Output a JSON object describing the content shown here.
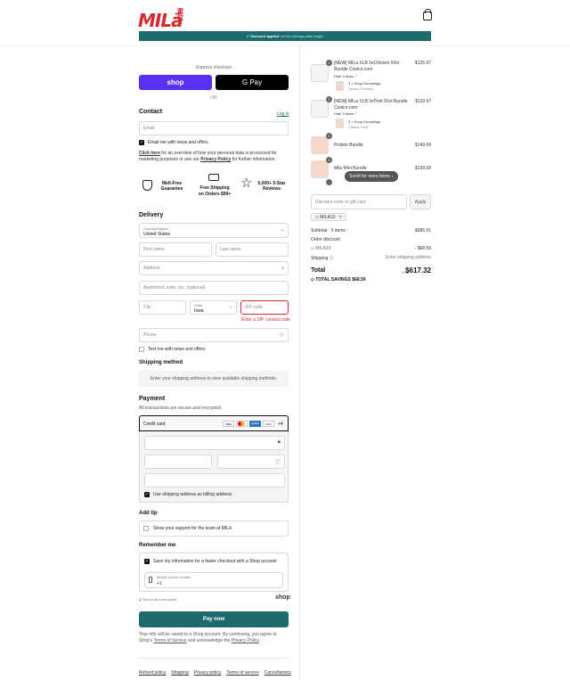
{
  "header": {
    "logo_text": "MILā",
    "logo_sub": "蜜拉"
  },
  "banner": {
    "label": "Discount applied",
    "detail": "Let the savings party begin!"
  },
  "express": {
    "title": "Express checkout",
    "shop_label": "shop",
    "gpay_label": "G Pay",
    "or": "OR"
  },
  "contact": {
    "title": "Contact",
    "login": "Log in",
    "email_placeholder": "Email",
    "email_news": "Email me with news and offers",
    "notice_link": "Click here",
    "notice_text": " for an overview of how your personal data is processed for marketing purposes or see our ",
    "privacy_link": "Privacy Policy",
    "notice_end": " for further information."
  },
  "badges": [
    {
      "icon": "shield-icon",
      "line1": "Melt-Free",
      "line2": "Guarantee"
    },
    {
      "icon": "truck-icon",
      "line1": "Free Shipping",
      "line2": "on Orders $99+"
    },
    {
      "icon": "star-icon",
      "line1": "5,000+ 5-Star",
      "line2": "Reviews"
    }
  ],
  "delivery": {
    "title": "Delivery",
    "country_label": "Country/Region",
    "country_value": "United States",
    "first_name": "First name",
    "last_name": "Last name",
    "address": "Address",
    "apartment": "Apartment, suite, etc. (optional)",
    "city": "City",
    "state_label": "State",
    "state_value": "Iowa",
    "zip": "ZIP code",
    "zip_error": "Enter a ZIP / postal code",
    "phone": "Phone",
    "text_news": "Text me with news and offers"
  },
  "shipping": {
    "title": "Shipping method",
    "placeholder": "Enter your shipping address to view available shipping methods."
  },
  "payment": {
    "title": "Payment",
    "subtitle": "All transactions are secure and encrypted.",
    "method": "Credit card",
    "cards": [
      "VISA",
      "MC",
      "AMEX",
      "DISC"
    ],
    "more": "+4",
    "billing_same": "Use shipping address as billing address"
  },
  "tip": {
    "title": "Add tip",
    "option": "Show your support for the team at MILā"
  },
  "remember": {
    "title": "Remember me",
    "save": "Save my information for a faster checkout with a Shop account",
    "mobile_label": "Mobile phone number",
    "mobile_value": "+1",
    "secure": "Secure and encrypted",
    "shop": "shop"
  },
  "pay": {
    "button": "Pay now",
    "legal_a": "Your info will be saved to a Shop account. By continuing, you agree to Shop's ",
    "terms": "Terms of Service",
    "legal_b": " and acknowledge the ",
    "privacy": "Privacy Policy",
    "legal_c": "."
  },
  "footer_links": [
    "Refund policy",
    "Shipping",
    "Privacy policy",
    "Terms of service",
    "Cancellations"
  ],
  "order": {
    "items": [
      {
        "qty": "1",
        "name": "[NEW] MILa XLB 3xChicken 50ct Bundle Costco.com",
        "hide": "Hide 3 items",
        "sub_name": "3 × Soup Dumplings",
        "sub_variant": "Savory Chicken",
        "price": "$125.97"
      },
      {
        "qty": "1",
        "name": "[NEW] MILa XLB 3xPork 50ct Bundle Costco.com",
        "hide": "Hide 3 items",
        "sub_name": "3 × Soup Dumplings",
        "sub_variant": "Classic Pork",
        "price": "$119.97"
      },
      {
        "qty": "1",
        "name": "Protein Bundle",
        "price": "$149.99"
      },
      {
        "qty": "1",
        "name": "Mila Mini Bundle",
        "price": "$139.99"
      }
    ],
    "scroll_hint": "Scroll for more items",
    "discount_placeholder": "Discount code or gift card",
    "apply": "Apply",
    "code_tag": "MILA10",
    "subtotal_label": "Subtotal · 5 items",
    "subtotal": "$685.91",
    "order_discount_label": "Order discount",
    "discount_code": "MILA10",
    "discount_value": "- $68.59",
    "shipping_label": "Shipping",
    "shipping_value": "Enter shipping address",
    "total_label": "Total",
    "currency": "USD",
    "total": "$617.32",
    "savings_label": "TOTAL SAVINGS",
    "savings": "$68.59"
  }
}
